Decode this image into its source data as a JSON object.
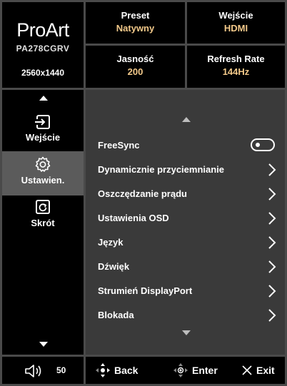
{
  "brand": {
    "logo": "ProArt",
    "model": "PA278CGRV",
    "resolution": "2560x1440"
  },
  "status": {
    "preset": {
      "label": "Preset",
      "value": "Natywny"
    },
    "input": {
      "label": "Wejście",
      "value": "HDMI"
    },
    "brightness": {
      "label": "Jasność",
      "value": "200"
    },
    "refresh": {
      "label": "Refresh Rate",
      "value": "144Hz"
    }
  },
  "sidebar": {
    "items": [
      {
        "label": "Wejście",
        "icon": "input-icon",
        "selected": false
      },
      {
        "label": "Ustawien.",
        "icon": "gear-icon",
        "selected": true
      },
      {
        "label": "Skrót",
        "icon": "shortcut-icon",
        "selected": false
      }
    ]
  },
  "menu": {
    "items": [
      {
        "label": "FreeSync",
        "control": "toggle",
        "state": "off"
      },
      {
        "label": "Dynamicznie przyciemnianie",
        "control": "chevron"
      },
      {
        "label": "Oszczędzanie prądu",
        "control": "chevron"
      },
      {
        "label": "Ustawienia OSD",
        "control": "chevron"
      },
      {
        "label": "Język",
        "control": "chevron"
      },
      {
        "label": "Dźwięk",
        "control": "chevron"
      },
      {
        "label": "Strumień DisplayPort",
        "control": "chevron"
      },
      {
        "label": "Blokada",
        "control": "chevron"
      }
    ]
  },
  "footer": {
    "volume": {
      "icon": "speaker-icon",
      "value": "50"
    },
    "back": {
      "label": "Back",
      "icon": "joystick-icon"
    },
    "enter": {
      "label": "Enter",
      "icon": "joystick-press-icon"
    },
    "exit": {
      "label": "Exit",
      "icon": "close-icon"
    }
  },
  "colors": {
    "value_accent": "#f3c98a",
    "panel_bg": "#3a3a3a",
    "selected_bg": "#5b5b5b"
  }
}
